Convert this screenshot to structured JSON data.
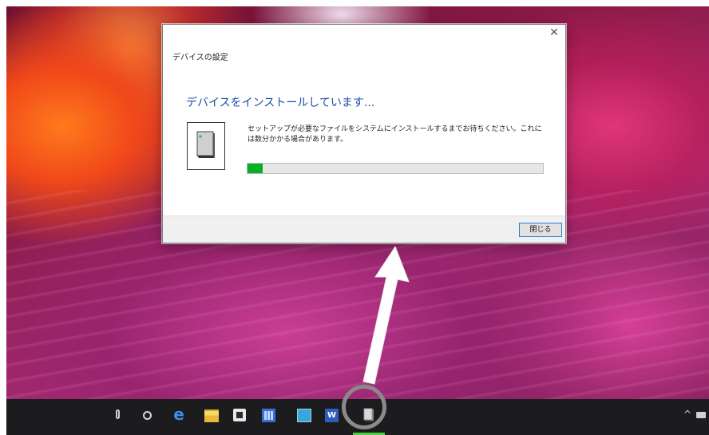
{
  "dialog": {
    "window_title": "デバイスの設定",
    "close_glyph": "✕",
    "heading": "デバイスをインストールしています...",
    "description": "セットアップが必要なファイルをシステムにインストールするまでお待ちください。これには数分かかる場合があります。",
    "progress_fraction": 0.05,
    "close_button_label": "閉じる"
  },
  "taskbar": {
    "icons": [
      "microphone-icon",
      "task-view-icon",
      "edge-browser-icon",
      "file-explorer-icon",
      "store-icon",
      "calculator-icon",
      "photos-icon",
      "word-icon",
      "device-setup-icon"
    ],
    "edge_glyph": "e",
    "word_glyph": "W",
    "tray_chevron": "^",
    "active_indicator_color": "#4ad04a"
  },
  "colors": {
    "heading": "#1d4fa6",
    "progress_fill": "#06b025",
    "highlight_circle": "#8a8a8a",
    "arrow": "#ffffff"
  }
}
